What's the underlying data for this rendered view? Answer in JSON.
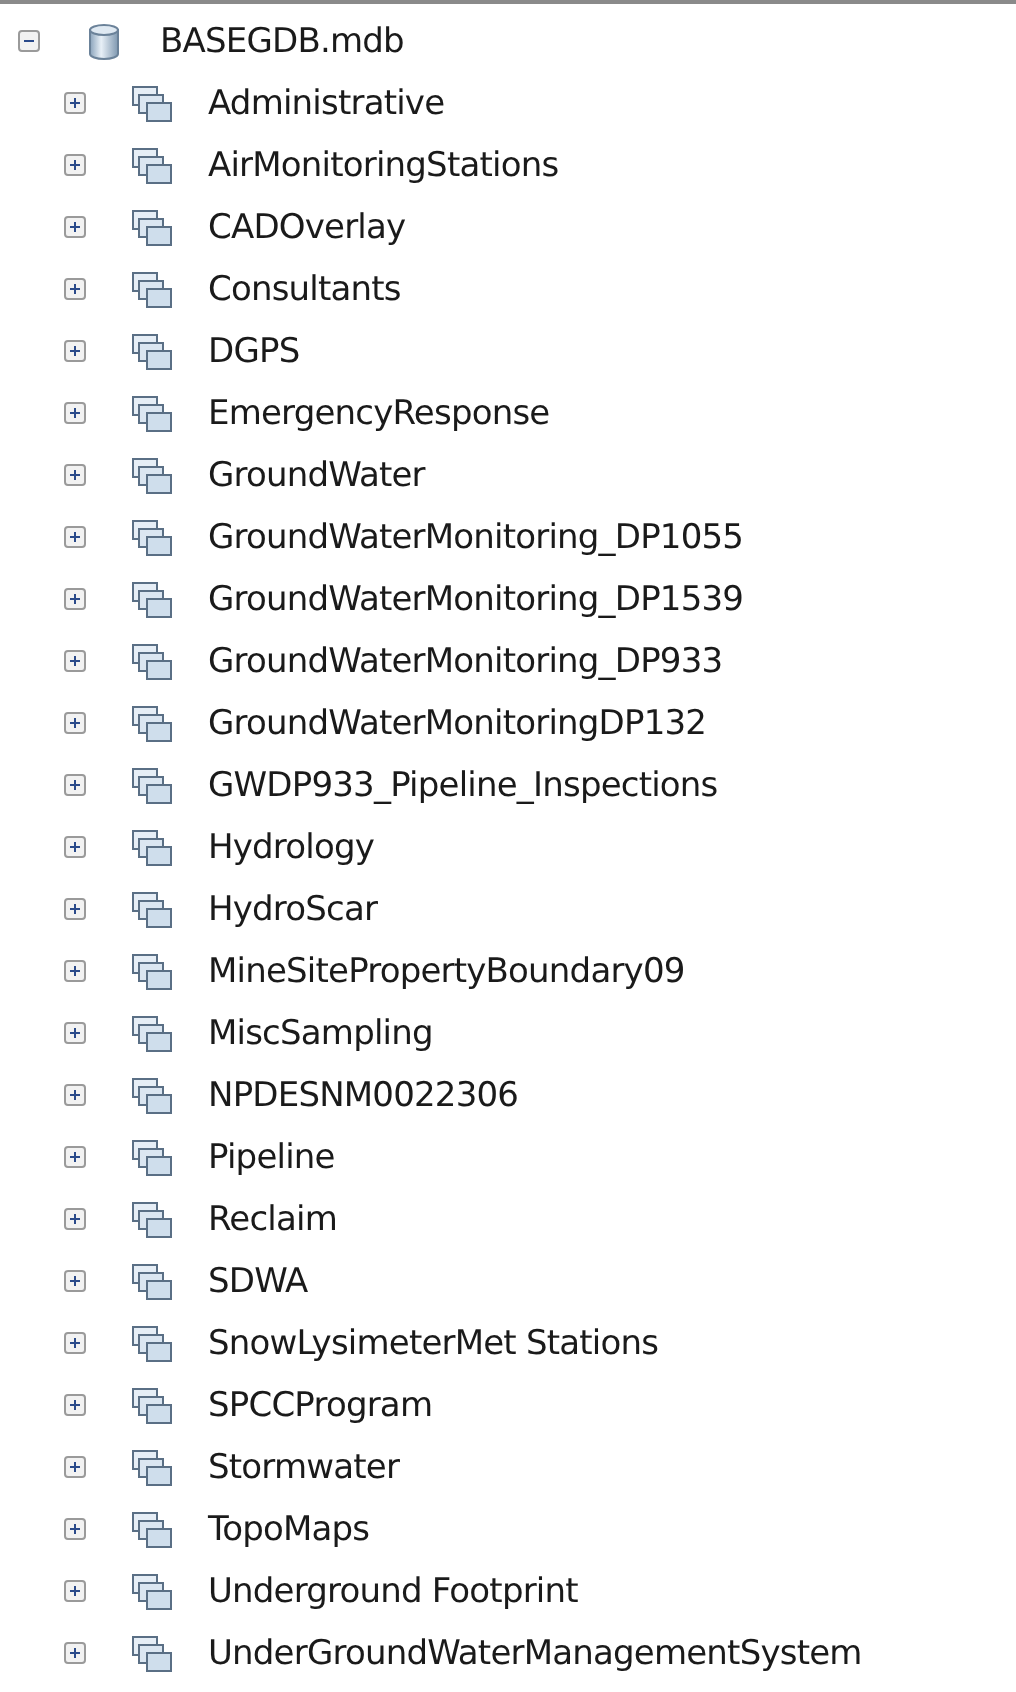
{
  "tree": {
    "label": "BASEGDB.mdb",
    "expanded": true,
    "children": [
      {
        "label": "Administrative",
        "expanded": false
      },
      {
        "label": "AirMonitoringStations",
        "expanded": false
      },
      {
        "label": "CADOverlay",
        "expanded": false
      },
      {
        "label": "Consultants",
        "expanded": false
      },
      {
        "label": "DGPS",
        "expanded": false
      },
      {
        "label": "EmergencyResponse",
        "expanded": false
      },
      {
        "label": "GroundWater",
        "expanded": false
      },
      {
        "label": "GroundWaterMonitoring_DP1055",
        "expanded": false
      },
      {
        "label": "GroundWaterMonitoring_DP1539",
        "expanded": false
      },
      {
        "label": "GroundWaterMonitoring_DP933",
        "expanded": false
      },
      {
        "label": "GroundWaterMonitoringDP132",
        "expanded": false
      },
      {
        "label": "GWDP933_Pipeline_Inspections",
        "expanded": false
      },
      {
        "label": "Hydrology",
        "expanded": false
      },
      {
        "label": "HydroScar",
        "expanded": false
      },
      {
        "label": "MineSitePropertyBoundary09",
        "expanded": false
      },
      {
        "label": "MiscSampling",
        "expanded": false
      },
      {
        "label": "NPDESNM0022306",
        "expanded": false
      },
      {
        "label": "Pipeline",
        "expanded": false
      },
      {
        "label": "Reclaim",
        "expanded": false
      },
      {
        "label": "SDWA",
        "expanded": false
      },
      {
        "label": "SnowLysimeterMet Stations",
        "expanded": false
      },
      {
        "label": "SPCCProgram",
        "expanded": false
      },
      {
        "label": "Stormwater",
        "expanded": false
      },
      {
        "label": "TopoMaps",
        "expanded": false
      },
      {
        "label": "Underground Footprint",
        "expanded": false
      },
      {
        "label": "UnderGroundWaterManagementSystem",
        "expanded": false
      }
    ]
  }
}
